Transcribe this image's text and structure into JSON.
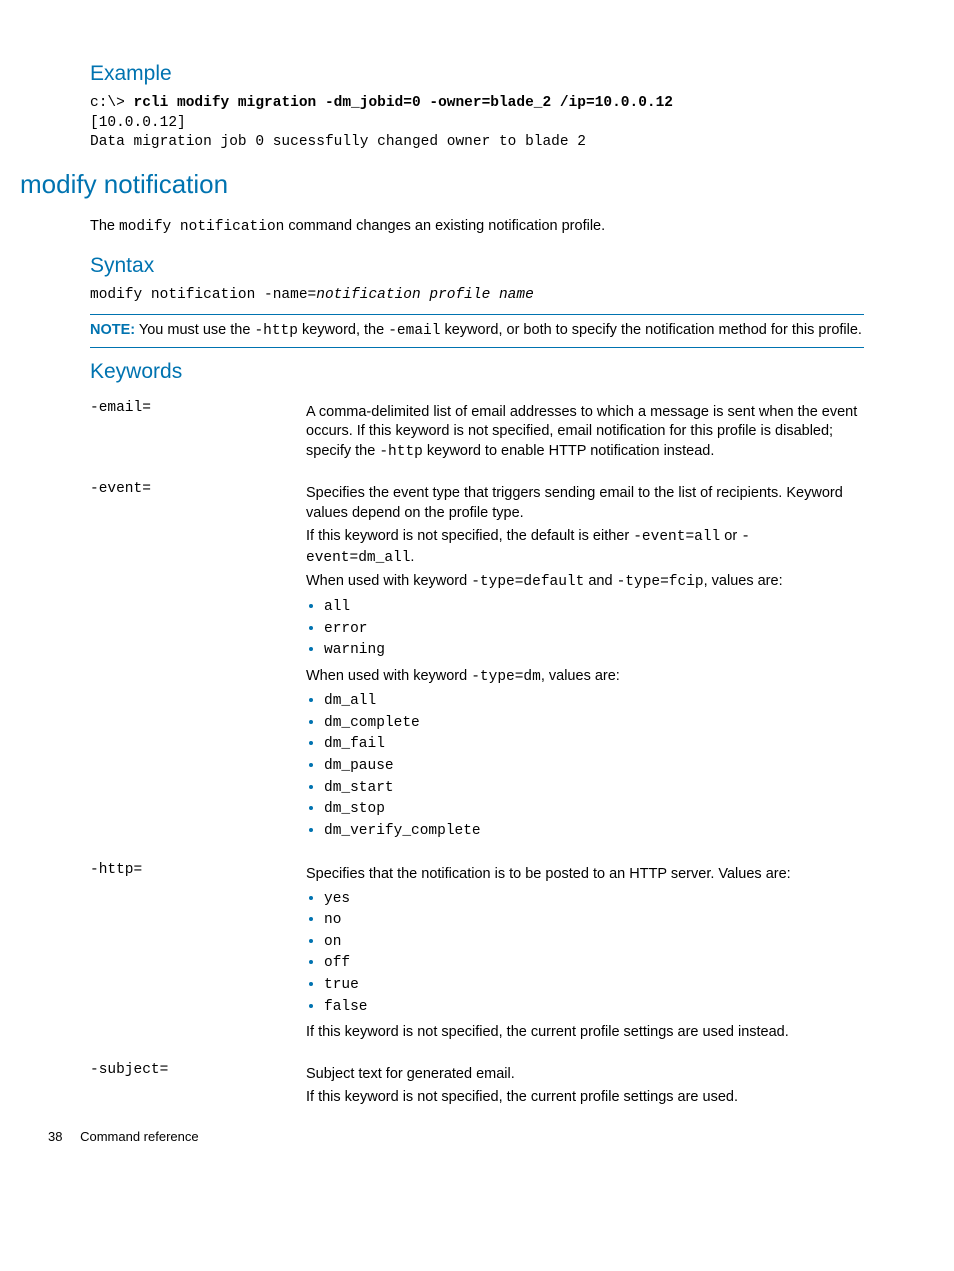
{
  "example": {
    "title": "Example",
    "line1_prefix": "c:\\> ",
    "line1_bold": "rcli modify migration -dm_jobid=0 -owner=blade_2 /ip=10.0.0.12",
    "line2": "[10.0.0.12]",
    "line3": "Data migration job 0 sucessfully changed owner to blade 2"
  },
  "modnotif": {
    "title": "modify notification",
    "intro_pre": "The ",
    "intro_code": "modify notification",
    "intro_post": " command changes an existing notification profile.",
    "syntax_title": "Syntax",
    "syntax_prefix": "modify notification -name=",
    "syntax_italic": "notification profile name",
    "note_label": "NOTE:",
    "note_pre": "You must use the ",
    "note_c1": "-http",
    "note_mid1": " keyword, the ",
    "note_c2": "-email",
    "note_post": " keyword, or both to specify the notification method for this profile.",
    "keywords_title": "Keywords"
  },
  "kw_email": {
    "name": "-email=",
    "d1a": "A comma-delimited list of email addresses to which a message is sent when the event occurs. If this keyword is not specified, email notification for this profile is disabled; specify the ",
    "d1c": "-http",
    "d1b": " keyword to enable HTTP notification instead."
  },
  "kw_event": {
    "name": "-event=",
    "d1": "Specifies the event type that triggers sending email to the list of recipients. Keyword values depend on the profile type.",
    "d2a": "If this keyword is not specified, the default is either ",
    "d2c1": "-event=all",
    "d2mid": " or ",
    "d2c2": "-event=dm_all",
    "d2end": ".",
    "d3a": "When used with keyword ",
    "d3c1": "-type=default",
    "d3mid": " and ",
    "d3c2": "-type=fcip",
    "d3end": ", values are:",
    "list1": [
      "all",
      "error",
      "warning"
    ],
    "d4a": "When used with keyword ",
    "d4c": "-type=dm",
    "d4end": ", values are:",
    "list2": [
      "dm_all",
      "dm_complete",
      "dm_fail",
      "dm_pause",
      "dm_start",
      "dm_stop",
      "dm_verify_complete"
    ]
  },
  "kw_http": {
    "name": "-http=",
    "d1": "Specifies that the notification is to be posted to an HTTP server. Values are:",
    "list": [
      "yes",
      "no",
      "on",
      "off",
      "true",
      "false"
    ],
    "d2": "If this keyword is not specified, the current profile settings are used instead."
  },
  "kw_subject": {
    "name": "-subject=",
    "d1": "Subject text for generated email.",
    "d2": "If this keyword is not specified, the current profile settings are used."
  },
  "footer": {
    "page": "38",
    "label": "Command reference"
  }
}
